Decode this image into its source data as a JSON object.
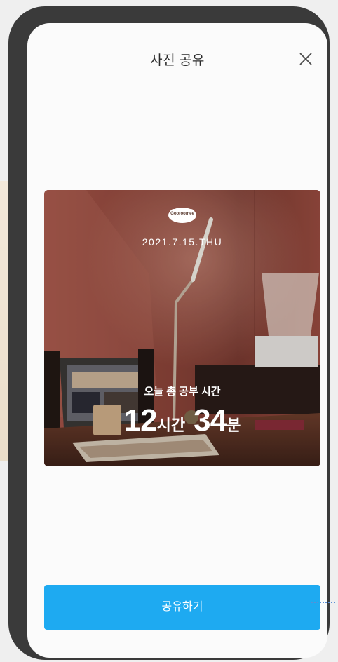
{
  "modal": {
    "title": "사진 공유",
    "close_icon": "close-icon"
  },
  "photo": {
    "logo_text": "Gooroomee",
    "date": "2021.7.15.THU",
    "study_label": "오늘 총 공부 시간",
    "hours_value": "12",
    "hours_unit": "시간",
    "minutes_value": "34",
    "minutes_unit": "분"
  },
  "actions": {
    "share_label": "공유하기"
  },
  "colors": {
    "accent": "#1eaaf1",
    "frame": "#3a3a3a"
  }
}
